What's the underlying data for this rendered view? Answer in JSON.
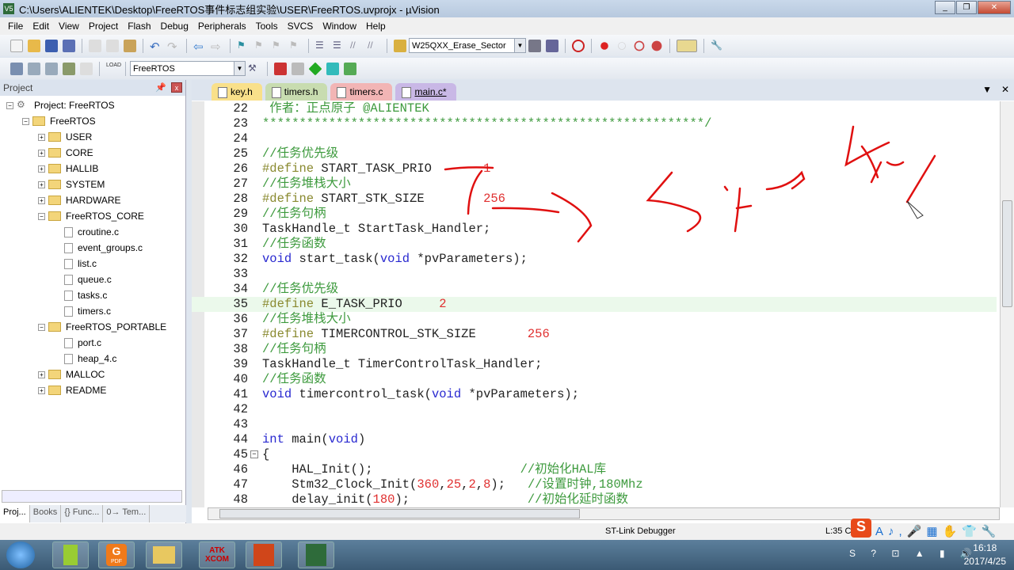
{
  "window": {
    "title": "C:\\Users\\ALIENTEK\\Desktop\\FreeRTOS事件标志组实验\\USER\\FreeRTOS.uvprojx - µVision",
    "app_icon": "V5"
  },
  "menu": [
    "File",
    "Edit",
    "View",
    "Project",
    "Flash",
    "Debug",
    "Peripherals",
    "Tools",
    "SVCS",
    "Window",
    "Help"
  ],
  "toolbar": {
    "find_combo": "W25QXX_Erase_Sector",
    "target_combo": "FreeRTOS",
    "load_label": "LOAD"
  },
  "project_panel": {
    "title": "Project",
    "tree": [
      {
        "label": "Project: FreeRTOS",
        "level": 0,
        "type": "project",
        "expanded": true
      },
      {
        "label": "FreeRTOS",
        "level": 1,
        "type": "target",
        "expanded": true
      },
      {
        "label": "USER",
        "level": 2,
        "type": "folder",
        "expanded": false
      },
      {
        "label": "CORE",
        "level": 2,
        "type": "folder",
        "expanded": false
      },
      {
        "label": "HALLIB",
        "level": 2,
        "type": "folder",
        "expanded": false
      },
      {
        "label": "SYSTEM",
        "level": 2,
        "type": "folder",
        "expanded": false
      },
      {
        "label": "HARDWARE",
        "level": 2,
        "type": "folder",
        "expanded": false
      },
      {
        "label": "FreeRTOS_CORE",
        "level": 2,
        "type": "folder",
        "expanded": true
      },
      {
        "label": "croutine.c",
        "level": 3,
        "type": "file"
      },
      {
        "label": "event_groups.c",
        "level": 3,
        "type": "file"
      },
      {
        "label": "list.c",
        "level": 3,
        "type": "file"
      },
      {
        "label": "queue.c",
        "level": 3,
        "type": "file"
      },
      {
        "label": "tasks.c",
        "level": 3,
        "type": "file"
      },
      {
        "label": "timers.c",
        "level": 3,
        "type": "file"
      },
      {
        "label": "FreeRTOS_PORTABLE",
        "level": 2,
        "type": "folder",
        "expanded": true
      },
      {
        "label": "port.c",
        "level": 3,
        "type": "file"
      },
      {
        "label": "heap_4.c",
        "level": 3,
        "type": "file"
      },
      {
        "label": "MALLOC",
        "level": 2,
        "type": "folder",
        "expanded": false
      },
      {
        "label": "README",
        "level": 2,
        "type": "folder",
        "expanded": false
      }
    ],
    "tabs": [
      "Proj...",
      "Books",
      "{} Func...",
      "0→ Tem..."
    ]
  },
  "editor": {
    "tabs": [
      {
        "label": "key.h",
        "color": "#f9e08a"
      },
      {
        "label": "timers.h",
        "color": "#c8dcb0"
      },
      {
        "label": "timers.c",
        "color": "#f2b5b5"
      },
      {
        "label": "main.c*",
        "color": "#c9b8e6",
        "active": true
      }
    ],
    "highlight_line": 35,
    "lines": [
      {
        "n": "22",
        "parts": [
          [
            " 作者：正点原子 @ALIENTEK",
            "cm"
          ]
        ]
      },
      {
        "n": "23",
        "parts": [
          [
            "************************************************************/",
            "cm"
          ]
        ]
      },
      {
        "n": "24",
        "parts": []
      },
      {
        "n": "25",
        "parts": [
          [
            "//任务优先级",
            "cm"
          ]
        ]
      },
      {
        "n": "26",
        "parts": [
          [
            "#define",
            "pp"
          ],
          [
            " START_TASK_PRIO       ",
            "tx"
          ],
          [
            "1",
            "nm"
          ]
        ]
      },
      {
        "n": "27",
        "parts": [
          [
            "//任务堆栈大小",
            "cm"
          ]
        ]
      },
      {
        "n": "28",
        "parts": [
          [
            "#define",
            "pp"
          ],
          [
            " START_STK_SIZE        ",
            "tx"
          ],
          [
            "256",
            "nm"
          ]
        ]
      },
      {
        "n": "29",
        "parts": [
          [
            "//任务句柄",
            "cm"
          ]
        ]
      },
      {
        "n": "30",
        "parts": [
          [
            "TaskHandle_t StartTask_Handler;",
            "tx"
          ]
        ]
      },
      {
        "n": "31",
        "parts": [
          [
            "//任务函数",
            "cm"
          ]
        ]
      },
      {
        "n": "32",
        "parts": [
          [
            "void",
            "kw"
          ],
          [
            " start_task(",
            "tx"
          ],
          [
            "void",
            "kw"
          ],
          [
            " *pvParameters);",
            "tx"
          ]
        ]
      },
      {
        "n": "33",
        "parts": []
      },
      {
        "n": "34",
        "parts": [
          [
            "//任务优先级",
            "cm"
          ]
        ]
      },
      {
        "n": "35",
        "parts": [
          [
            "#define",
            "pp"
          ],
          [
            " E_TASK_PRIO     ",
            "tx"
          ],
          [
            "2",
            "nm"
          ]
        ]
      },
      {
        "n": "36",
        "parts": [
          [
            "//任务堆栈大小",
            "cm"
          ]
        ]
      },
      {
        "n": "37",
        "parts": [
          [
            "#define",
            "pp"
          ],
          [
            " TIMERCONTROL_STK_SIZE       ",
            "tx"
          ],
          [
            "256",
            "nm"
          ]
        ]
      },
      {
        "n": "38",
        "parts": [
          [
            "//任务句柄",
            "cm"
          ]
        ]
      },
      {
        "n": "39",
        "parts": [
          [
            "TaskHandle_t TimerControlTask_Handler;",
            "tx"
          ]
        ]
      },
      {
        "n": "40",
        "parts": [
          [
            "//任务函数",
            "cm"
          ]
        ]
      },
      {
        "n": "41",
        "parts": [
          [
            "void",
            "kw"
          ],
          [
            " timercontrol_task(",
            "tx"
          ],
          [
            "void",
            "kw"
          ],
          [
            " *pvParameters);",
            "tx"
          ]
        ]
      },
      {
        "n": "42",
        "parts": []
      },
      {
        "n": "43",
        "parts": []
      },
      {
        "n": "44",
        "parts": [
          [
            "int",
            "kw"
          ],
          [
            " main(",
            "tx"
          ],
          [
            "void",
            "kw"
          ],
          [
            ")",
            "tx"
          ]
        ]
      },
      {
        "n": "45",
        "parts": [
          [
            "{",
            "tx"
          ]
        ]
      },
      {
        "n": "46",
        "parts": [
          [
            "    HAL_Init();                    ",
            "tx"
          ],
          [
            "//初始化HAL库",
            "cm"
          ]
        ]
      },
      {
        "n": "47",
        "parts": [
          [
            "    Stm32_Clock_Init(",
            "tx"
          ],
          [
            "360",
            "nm"
          ],
          [
            ",",
            "tx"
          ],
          [
            "25",
            "nm"
          ],
          [
            ",",
            "tx"
          ],
          [
            "2",
            "nm"
          ],
          [
            ",",
            "tx"
          ],
          [
            "8",
            "nm"
          ],
          [
            ");   ",
            "tx"
          ],
          [
            "//设置时钟,180Mhz",
            "cm"
          ]
        ]
      },
      {
        "n": "48",
        "parts": [
          [
            "    delay_init(",
            "tx"
          ],
          [
            "180",
            "nm"
          ],
          [
            ");                ",
            "tx"
          ],
          [
            "//初始化延时函数",
            "cm"
          ]
        ]
      }
    ]
  },
  "status": {
    "debugger": "ST-Link Debugger",
    "position": "L:35 C"
  },
  "taskbar": {
    "apps": [
      "Notepad++",
      "PDF",
      "Explorer",
      "ATK XCOM",
      "PowerPoint",
      "µVision"
    ],
    "time": "16:18",
    "date": "2017/4/25"
  },
  "colors": {
    "comment": "#3d9a3d",
    "preprocessor": "#8a8a30",
    "keyword": "#2828d0",
    "number": "#e03030",
    "ink": "#e01010"
  }
}
